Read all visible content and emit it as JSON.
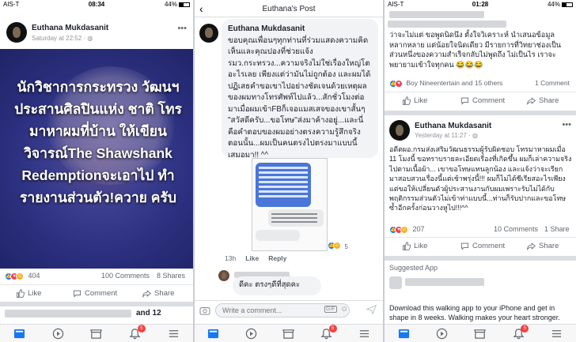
{
  "status_bar": [
    {
      "carrier": "AIS-T",
      "time": "08:34",
      "battery": "44%"
    },
    {
      "carrier": "",
      "time": "",
      "battery": ""
    },
    {
      "carrier": "AIS-T",
      "time": "01:28",
      "battery": "44%"
    }
  ],
  "panel1": {
    "author": "Euthana Mukdasanit",
    "timestamp": "Saturday at 22:52 · ",
    "image_text": "นักวิชาการกระทรวง วัฒนฯประสานศิลปินแห่ง ชาติ โทรมาหาผมที่บ้าน ให้เขียนวิจารณ์The Shawshank Redemptionจะเอาไป ทำรายงานส่วนตัว!ควาย ครับ",
    "reaction_count": "404",
    "comments": "100 Comments",
    "shares": "8 Shares",
    "like_label": "Like",
    "comment_label": "Comment",
    "share_label": "Share",
    "next_preview": "and 12"
  },
  "panel2": {
    "header_title": "Euthana's Post",
    "author": "Euthana Mukdasanit",
    "comment_text": "ขอบคุณเพื่อนๆทุกท่านที่ร่วมแสดงความคิดเห็นและคุณปองที่ช่วยแจ้ง รมว.กระทรวง...ความจริงไม่ใช่เรื่องใหญ่โตอะไรเลย เพียงแต่ว่ามันไม่ถูกต้อง และผมได้ปฏิเสธคำขอเขาไปอย่างชัดเจนด้วยเหตุผลของผมทางโทรศัพท์ไปแล้ว...สักชั่วโมงต่อมาเมื่อผมเข้าFBก็เจอแมสเสจของเขาสั้นๆ \"สวัสดีครับ...ขอโทษ\"ส่งมาค้างอยู่...และนี่คือคำตอบของผมอย่างตรงความรู้สึกจริงตอนนั้น...ผมเป็นคนตรงไปตรงมาแบบนี้เสมอมา!! ^^",
    "screenshot_reply": "ดีคะ ตรงๆดีที่สุดคะ",
    "time": "13h",
    "like_label": "Like",
    "reply_label": "Reply",
    "reaction_count": "5",
    "input_placeholder": "Write a comment...",
    "gif_label": "GIF"
  },
  "panel3": {
    "top_text": "ว่าจะไม่แต่ ขอพูดนิดนึง ตั้งใจวิเคราะห์ นำเสนอข้อมูลหลากหลาย แต่น้อยใจนิดเดียว มีรายการที่วิทยาช่องเป็นส่วนหนึ่งของความสำเร็จกลับไม่พูดถึง ไม่เป็นไร เราจะพยายามเข้าใจทุกคน 😂😂😂",
    "liked_by": "Boy Nineentertain and 15 others",
    "top_comments": "1 Comment",
    "like_label": "Like",
    "comment_label": "Comment",
    "share_label": "Share",
    "author": "Euthana Mukdasanit",
    "timestamp": "Yesterday at 11:27 · ",
    "post_text": "อดีตผอ.กรมส่งเสริมวัฒนธรรมผู้รับผิดชอบ โทรมาหาผมเมื่อ 11 โมงนี้ ขอทราบรายละเอียดเรื่องที่เกิดขึ้น ผมก็เล่าความจริงไปตามเนื้อผ้า... เขาขอโทษแทนลูกน้อง และแจ้งว่าจะเรียกมาสอบสวนเรื่องนี้แต่เช้าพรุ่งนี้!!! ผมก็ไม่ได้ซีเรียสอะไรเพียงแต่ขอให้เปลี่ยนตัวผู้ประสานงานกับผมเพราะรับไม่ได้กับพฤติกรรมส่วนตัวไม่เข้าท่าแบบนี้...ท่านก็รับปากและขอโทษซ้ำอีกครั้งก่อนวางหูไป!!!^^",
    "reaction_count": "207",
    "comments": "10 Comments",
    "shares": "1 Share",
    "suggested_label": "Suggested App",
    "ad_text": "Download this walking app to your iPhone and get in shape in 8 weeks. Walking makes your heart stronger."
  },
  "tabbar": {
    "notification_badge": "5"
  }
}
